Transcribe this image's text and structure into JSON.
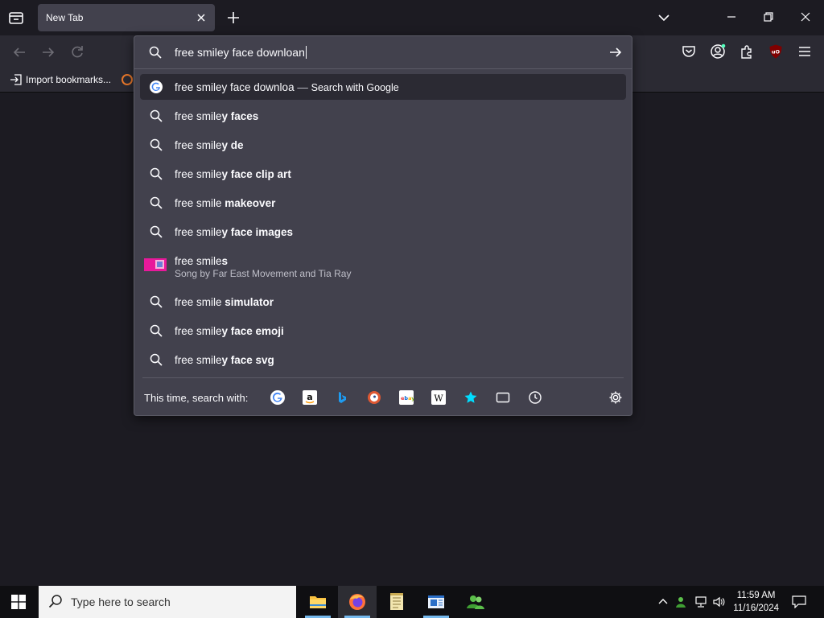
{
  "tabs": [
    {
      "label": "New Tab"
    }
  ],
  "bookmarks": {
    "import_label": "Import bookmarks..."
  },
  "urlbar": {
    "value": "free smiley face downloan"
  },
  "suggestions": [
    {
      "kind": "search-google",
      "typed": "free smiley face downloa",
      "bold": "",
      "action": "Search with Google",
      "icon": "google-icon"
    },
    {
      "kind": "search",
      "typed": "free smile",
      "bold": "y faces",
      "icon": "search-icon"
    },
    {
      "kind": "search",
      "typed": "free smile",
      "bold": "y de",
      "icon": "search-icon"
    },
    {
      "kind": "search",
      "typed": "free smile",
      "bold": "y face clip art",
      "icon": "search-icon"
    },
    {
      "kind": "search",
      "typed": "free smile ",
      "bold": "makeover",
      "icon": "search-icon"
    },
    {
      "kind": "search",
      "typed": "free smile",
      "bold": "y face images",
      "icon": "search-icon"
    },
    {
      "kind": "rich",
      "typed": "free smile",
      "bold": "s",
      "subtitle": "Song by Far East Movement and Tia Ray",
      "icon": "album-thumbnail"
    },
    {
      "kind": "search",
      "typed": "free smile ",
      "bold": "simulator",
      "icon": "search-icon"
    },
    {
      "kind": "search",
      "typed": "free smile",
      "bold": "y face emoji",
      "icon": "search-icon"
    },
    {
      "kind": "search",
      "typed": "free smile",
      "bold": "y face svg",
      "icon": "search-icon"
    }
  ],
  "search_with": {
    "label": "This time, search with:",
    "engines": [
      "google-icon",
      "amazon-icon",
      "bing-icon",
      "duckduckgo-icon",
      "ebay-icon",
      "wikipedia-icon",
      "bookmarks-star-icon",
      "tabs-icon",
      "history-icon"
    ]
  },
  "taskbar": {
    "search_placeholder": "Type here to search",
    "time": "11:59 AM",
    "date": "11/16/2024"
  },
  "colors": {
    "accent": "#76b9ed",
    "panel": "#42414d",
    "toolbar": "#2b2a33",
    "background": "#1c1b22"
  }
}
